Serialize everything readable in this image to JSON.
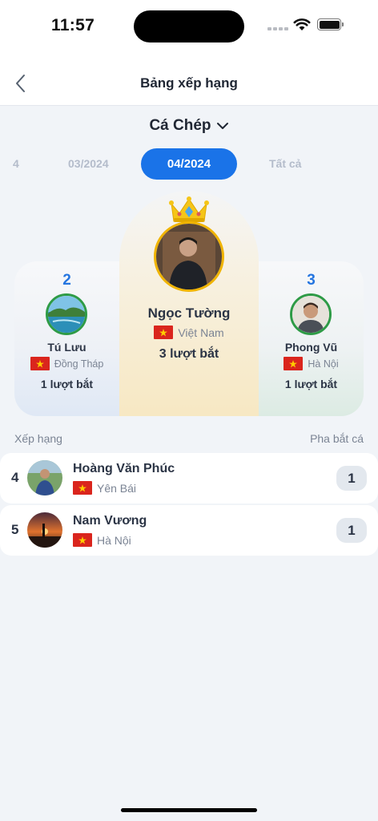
{
  "status_bar": {
    "time": "11:57"
  },
  "header": {
    "title": "Bảng xếp hạng",
    "back_icon": "chevron-left-icon"
  },
  "fish_selector": {
    "label": "Cá Chép",
    "icon": "chevron-down-icon"
  },
  "tabs": [
    {
      "label": "4"
    },
    {
      "label": "03/2024"
    },
    {
      "label": "04/2024",
      "active": true
    },
    {
      "label": "Tất cả"
    }
  ],
  "podium": {
    "first": {
      "name": "Ngọc Tường",
      "location": "Việt Nam",
      "count": "3 lượt bắt"
    },
    "second": {
      "rank": "2",
      "name": "Tú Lưu",
      "location": "Đồng Tháp",
      "count": "1 lượt bắt"
    },
    "third": {
      "rank": "3",
      "name": "Phong Vũ",
      "location": "Hà Nội",
      "count": "1 lượt bắt"
    }
  },
  "list": {
    "header_left": "Xếp hạng",
    "header_right": "Pha bắt cá",
    "rows": [
      {
        "rank": "4",
        "name": "Hoàng Văn Phúc",
        "location": "Yên Bái",
        "count": "1"
      },
      {
        "rank": "5",
        "name": "Nam Vương",
        "location": "Hà Nội",
        "count": "1"
      }
    ]
  },
  "colors": {
    "accent": "#1a73e8",
    "gold": "#f0b400",
    "green_ring": "#2e9b46",
    "flag_red": "#da251d",
    "flag_star": "#ffcd00"
  }
}
